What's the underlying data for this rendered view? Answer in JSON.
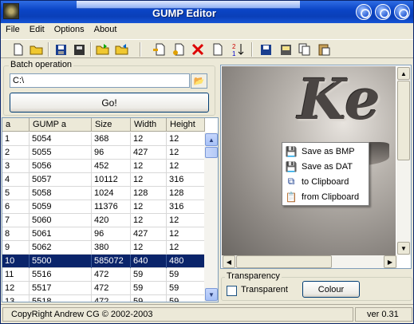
{
  "window": {
    "title": "GUMP Editor"
  },
  "menu": [
    "File",
    "Edit",
    "Options",
    "About"
  ],
  "toolbar": {
    "icons": [
      "new-file-icon",
      "open-folder-icon",
      "save-icon",
      "save-all-icon",
      "export-icon",
      "import-icon",
      "insert-icon",
      "add-icon",
      "delete-icon",
      "blank-icon",
      "sort-icon",
      "save-bmp-icon",
      "save-dat-icon",
      "copy-icon",
      "paste-icon"
    ]
  },
  "batch": {
    "title": "Batch operation",
    "path_value": "C:\\",
    "go_label": "Go!"
  },
  "table": {
    "headers": [
      "a",
      "GUMP a",
      "Size",
      "Width",
      "Height"
    ],
    "rows": [
      [
        "1",
        "5054",
        "368",
        "12",
        "12"
      ],
      [
        "2",
        "5055",
        "96",
        "427",
        "12"
      ],
      [
        "3",
        "5056",
        "452",
        "12",
        "12"
      ],
      [
        "4",
        "5057",
        "10112",
        "12",
        "316"
      ],
      [
        "5",
        "5058",
        "1024",
        "128",
        "128"
      ],
      [
        "6",
        "5059",
        "11376",
        "12",
        "316"
      ],
      [
        "7",
        "5060",
        "420",
        "12",
        "12"
      ],
      [
        "8",
        "5061",
        "96",
        "427",
        "12"
      ],
      [
        "9",
        "5062",
        "380",
        "12",
        "12"
      ],
      [
        "10",
        "5500",
        "585072",
        "640",
        "480"
      ],
      [
        "11",
        "5516",
        "472",
        "59",
        "59"
      ],
      [
        "12",
        "5517",
        "472",
        "59",
        "59"
      ],
      [
        "13",
        "5518",
        "472",
        "59",
        "59"
      ]
    ],
    "selected_row": 9
  },
  "context_menu": [
    {
      "label": "Save as BMP",
      "icon": "save-bmp-icon"
    },
    {
      "label": "Save as DAT",
      "icon": "save-dat-icon"
    },
    {
      "label": "to Clipboard",
      "icon": "copy-icon"
    },
    {
      "label": "from Clipboard",
      "icon": "paste-icon"
    }
  ],
  "transparency": {
    "title": "Transparency",
    "checkbox_label": "Transparent",
    "checked": false,
    "colour_label": "Colour"
  },
  "status": {
    "copyright": "CopyRight Andrew CG © 2002-2003",
    "version": "ver 0.31"
  }
}
